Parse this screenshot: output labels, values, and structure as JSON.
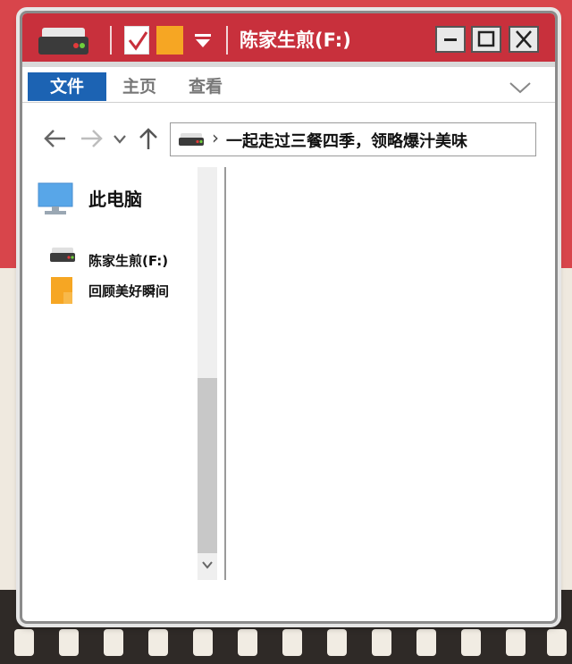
{
  "window": {
    "title": "陈家生煎(F:)"
  },
  "titlebar": {
    "icons": [
      "drive-icon",
      "checkbox-icon",
      "folder-icon",
      "dropdown-arrow-icon"
    ],
    "buttons": [
      "minimize-icon",
      "maximize-icon",
      "close-icon"
    ]
  },
  "ribbon": {
    "tabs": [
      {
        "label": "文件",
        "active": true
      },
      {
        "label": "主页",
        "active": false
      },
      {
        "label": "查看",
        "active": false
      }
    ],
    "active_color": "#1c63b3"
  },
  "navigation": {
    "back_icon": "arrow-left-icon",
    "forward_icon": "arrow-right-icon",
    "recent_icon": "chevron-down-icon",
    "up_icon": "arrow-up-icon"
  },
  "address": {
    "separator": "›",
    "path": "一起走过三餐四季，领略爆汁美味"
  },
  "sidebar": {
    "root": {
      "label": "此电脑",
      "icon": "monitor-icon"
    },
    "items": [
      {
        "label": "陈家生煎(F:)",
        "icon": "drive-icon"
      },
      {
        "label": "回顾美好瞬间",
        "icon": "folder-icon"
      }
    ]
  },
  "colors": {
    "titlebar": "#c8303c",
    "folder": "#f6a623",
    "background_red": "#d8454b"
  }
}
